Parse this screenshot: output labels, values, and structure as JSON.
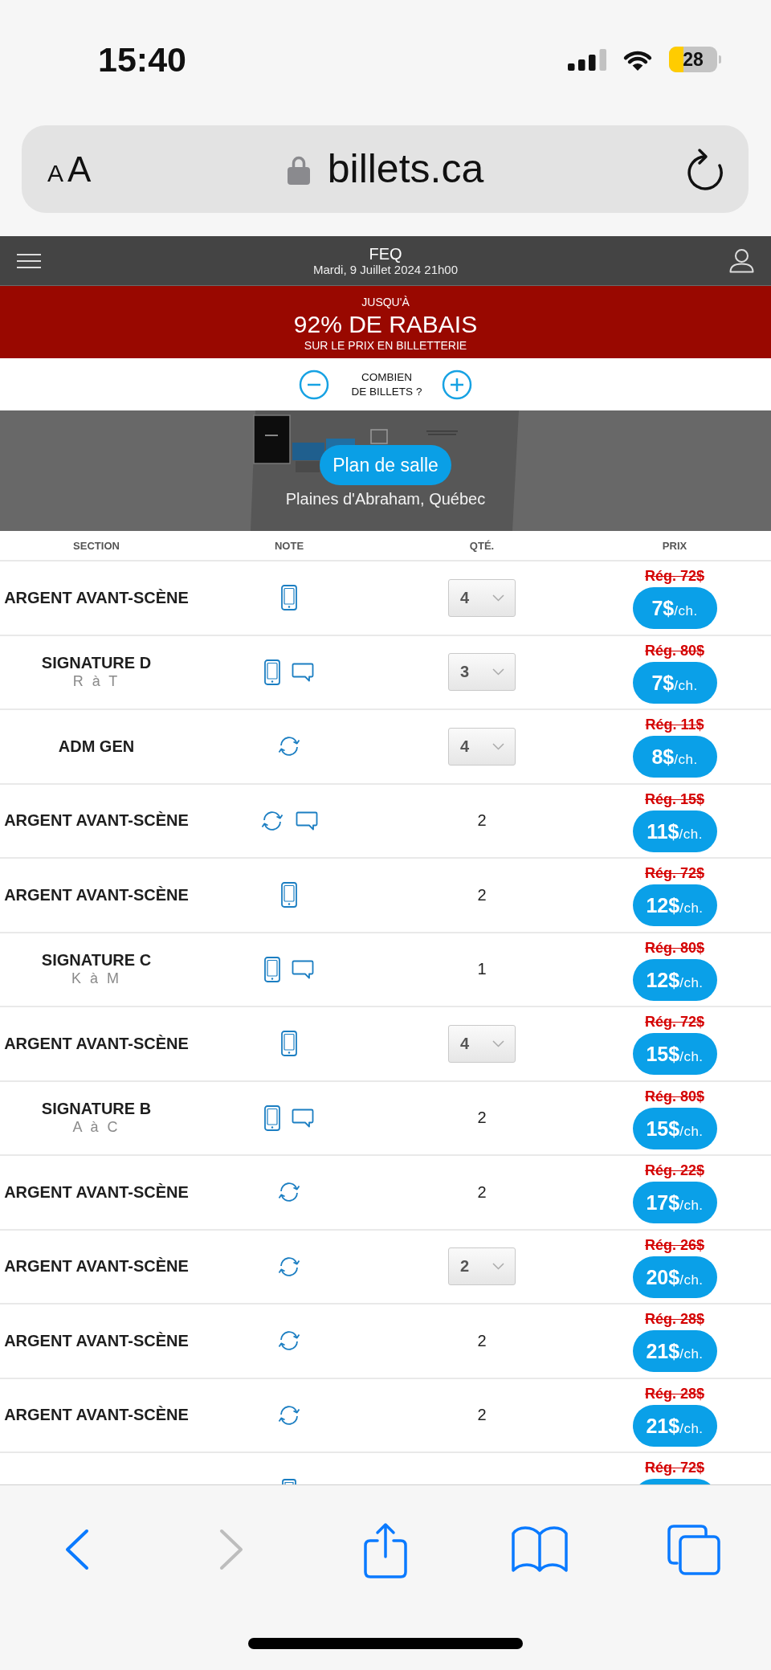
{
  "status_bar": {
    "time": "15:40",
    "battery": "28"
  },
  "address_bar": {
    "text_size": "AA",
    "url": "billets.ca"
  },
  "site_header": {
    "title": "FEQ",
    "date": "Mardi, 9 Juillet 2024 21h00"
  },
  "promo_banner": {
    "kicker": "JUSQU'À",
    "headline": "92% DE RABAIS",
    "subline": "SUR LE PRIX EN BILLETTERIE"
  },
  "ticket_count": {
    "label": "COMBIEN\nDE BILLETS ?"
  },
  "venue_map": {
    "button": "Plan de salle",
    "venue": "Plaines d'Abraham, Québec"
  },
  "table": {
    "columns": [
      "SECTION",
      "NOTE",
      "QTÉ.",
      "PRIX"
    ],
    "rows": [
      {
        "kind": "full",
        "section": "ARGENT AVANT-SCÈNE",
        "notes": [
          {
            "kind": "mobile"
          }
        ],
        "qty": {
          "kind": "select",
          "value": "4"
        },
        "old_price": "Rég. 72$",
        "price": "7$",
        "unit": "/ch."
      },
      {
        "kind": "full",
        "section": "SIGNATURE D",
        "seats": "R à T",
        "notes": [
          {
            "kind": "mobile"
          },
          {
            "kind": "comment"
          }
        ],
        "qty": {
          "kind": "select",
          "value": "3"
        },
        "old_price": "Rég. 80$",
        "price": "7$",
        "unit": "/ch."
      },
      {
        "kind": "full",
        "section": "ADM GEN",
        "notes": [
          {
            "kind": "exchange"
          }
        ],
        "qty": {
          "kind": "select",
          "value": "4"
        },
        "old_price": "Rég. 11$",
        "price": "8$",
        "unit": "/ch."
      },
      {
        "kind": "full",
        "section": "ARGENT AVANT-SCÈNE",
        "notes": [
          {
            "kind": "exchange"
          },
          {
            "kind": "comment"
          }
        ],
        "qty": {
          "kind": "text",
          "value": "2"
        },
        "old_price": "Rég. 15$",
        "price": "11$",
        "unit": "/ch."
      },
      {
        "kind": "full",
        "section": "ARGENT AVANT-SCÈNE",
        "notes": [
          {
            "kind": "mobile"
          }
        ],
        "qty": {
          "kind": "text",
          "value": "2"
        },
        "old_price": "Rég. 72$",
        "price": "12$",
        "unit": "/ch."
      },
      {
        "kind": "full",
        "section": "SIGNATURE C",
        "seats": "K à M",
        "notes": [
          {
            "kind": "mobile"
          },
          {
            "kind": "comment"
          }
        ],
        "qty": {
          "kind": "text",
          "value": "1"
        },
        "old_price": "Rég. 80$",
        "price": "12$",
        "unit": "/ch."
      },
      {
        "kind": "full",
        "section": "ARGENT AVANT-SCÈNE",
        "notes": [
          {
            "kind": "mobile"
          }
        ],
        "qty": {
          "kind": "select",
          "value": "4"
        },
        "old_price": "Rég. 72$",
        "price": "15$",
        "unit": "/ch."
      },
      {
        "kind": "full",
        "section": "SIGNATURE B",
        "seats": "A à C",
        "notes": [
          {
            "kind": "mobile"
          },
          {
            "kind": "comment"
          }
        ],
        "qty": {
          "kind": "text",
          "value": "2"
        },
        "old_price": "Rég. 80$",
        "price": "15$",
        "unit": "/ch."
      },
      {
        "kind": "full",
        "section": "ARGENT AVANT-SCÈNE",
        "notes": [
          {
            "kind": "exchange"
          }
        ],
        "qty": {
          "kind": "text",
          "value": "2"
        },
        "old_price": "Rég. 22$",
        "price": "17$",
        "unit": "/ch."
      },
      {
        "kind": "full",
        "section": "ARGENT AVANT-SCÈNE",
        "notes": [
          {
            "kind": "exchange"
          }
        ],
        "qty": {
          "kind": "select",
          "value": "2"
        },
        "old_price": "Rég. 26$",
        "price": "20$",
        "unit": "/ch."
      },
      {
        "kind": "full",
        "section": "ARGENT AVANT-SCÈNE",
        "notes": [
          {
            "kind": "exchange"
          }
        ],
        "qty": {
          "kind": "text",
          "value": "2"
        },
        "old_price": "Rég. 28$",
        "price": "21$",
        "unit": "/ch."
      },
      {
        "kind": "full",
        "section": "ARGENT AVANT-SCÈNE",
        "notes": [
          {
            "kind": "exchange"
          }
        ],
        "qty": {
          "kind": "text",
          "value": "2"
        },
        "old_price": "Rég. 28$",
        "price": "21$",
        "unit": "/ch."
      },
      {
        "kind": "cut",
        "notes": [
          {
            "kind": "mobile"
          }
        ],
        "old_price": "Rég. 72$"
      }
    ]
  },
  "toolbar": {
    "buttons": [
      {
        "kind": "back",
        "disabled": false
      },
      {
        "kind": "forward",
        "disabled": true
      },
      {
        "kind": "share",
        "disabled": false
      },
      {
        "kind": "bookmarks",
        "disabled": false
      },
      {
        "kind": "tabs",
        "disabled": false
      }
    ]
  }
}
